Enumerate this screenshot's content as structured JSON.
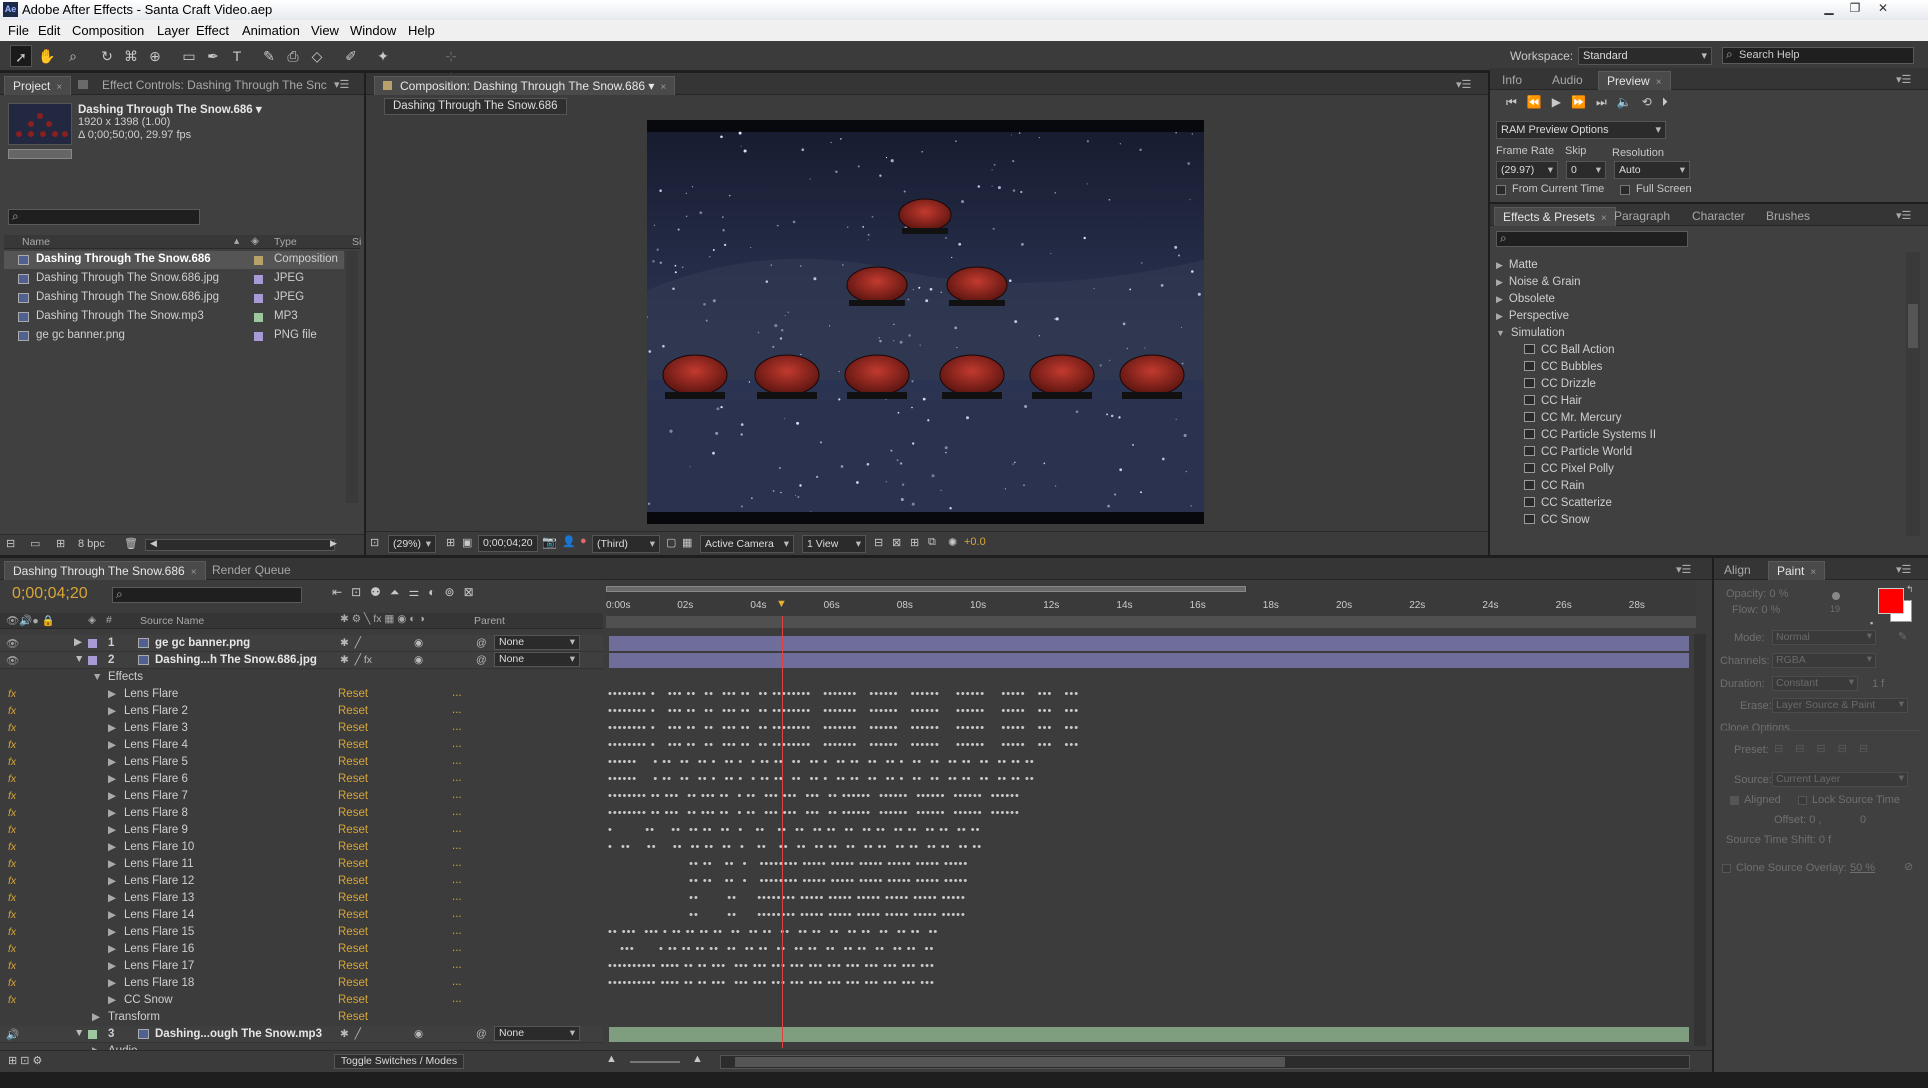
{
  "window": {
    "title": "Adobe After Effects - Santa Craft Video.aep",
    "app_icon": "Ae"
  },
  "menu": [
    "File",
    "Edit",
    "Composition",
    "Layer",
    "Effect",
    "Animation",
    "View",
    "Window",
    "Help"
  ],
  "toolbar": {
    "workspace_label": "Workspace:",
    "workspace_value": "Standard",
    "search_help_placeholder": "Search Help"
  },
  "project_panel": {
    "tabs": [
      "Project",
      "Effect Controls: Dashing Through The Snc"
    ],
    "selected_name": "Dashing Through The Snow.686 ▾",
    "selected_info1": "1920 x 1398 (1.00)",
    "selected_info2": "Δ 0;00;50;00, 29.97 fps",
    "columns": {
      "name": "Name",
      "type": "Type",
      "size": "Si"
    },
    "items": [
      {
        "name": "Dashing Through The Snow.686",
        "type": "Composition",
        "color": "#b9a26a",
        "icon": "composition-icon"
      },
      {
        "name": "Dashing Through The Snow.686.jpg",
        "type": "JPEG",
        "color": "#a79ad6",
        "icon": "image-icon"
      },
      {
        "name": "Dashing Through The Snow.686.jpg",
        "type": "JPEG",
        "color": "#a79ad6",
        "icon": "image-icon"
      },
      {
        "name": "Dashing Through The Snow.mp3",
        "type": "MP3",
        "color": "#9dc79d",
        "icon": "audio-icon"
      },
      {
        "name": "ge gc banner.png",
        "type": "PNG file",
        "color": "#a79ad6",
        "icon": "image-icon"
      }
    ],
    "bpc": "8 bpc"
  },
  "composition_panel": {
    "tab": "Composition: Dashing Through The Snow.686",
    "subtab": "Dashing Through The Snow.686",
    "zoom": "(29%)",
    "timecode": "0;00;04;20",
    "resolution": "(Third)",
    "camera": "Active Camera",
    "views": "1 View",
    "exposure": "+0.0"
  },
  "preview_panel": {
    "tabs": [
      "Info",
      "Audio",
      "Preview"
    ],
    "ram_preview": "RAM Preview Options",
    "frame_rate_label": "Frame Rate",
    "skip_label": "Skip",
    "resolution_label": "Resolution",
    "frame_rate": "(29.97)",
    "skip": "0",
    "resolution": "Auto",
    "from_current_time": "From Current Time",
    "full_screen": "Full Screen"
  },
  "effects_panel": {
    "tabs": [
      "Effects & Presets",
      "Paragraph",
      "Character",
      "Brushes"
    ],
    "categories": [
      "Matte",
      "Noise & Grain",
      "Obsolete",
      "Perspective",
      "Simulation"
    ],
    "simulation_items": [
      "CC Ball Action",
      "CC Bubbles",
      "CC Drizzle",
      "CC Hair",
      "CC Mr. Mercury",
      "CC Particle Systems II",
      "CC Particle World",
      "CC Pixel Polly",
      "CC Rain",
      "CC Scatterize",
      "CC Snow"
    ]
  },
  "timeline": {
    "tabs": [
      "Dashing Through The Snow.686",
      "Render Queue"
    ],
    "timecode": "0;00;04;20",
    "ruler": [
      "0:00s",
      "02s",
      "04s",
      "06s",
      "08s",
      "10s",
      "12s",
      "14s",
      "16s",
      "18s",
      "20s",
      "22s",
      "24s",
      "26s",
      "28s"
    ],
    "columns": {
      "num": "#",
      "source": "Source Name",
      "parent": "Parent"
    },
    "layers": [
      {
        "num": "1",
        "name": "ge gc banner.png",
        "parent": "None",
        "color": "#a79ad6"
      },
      {
        "num": "2",
        "name": "Dashing...h The Snow.686.jpg",
        "parent": "None",
        "color": "#a79ad6"
      },
      {
        "num": "3",
        "name": "Dashing...ough The Snow.mp3",
        "parent": "None",
        "color": "#9dc79d"
      }
    ],
    "effects_label": "Effects",
    "effects": [
      "Lens Flare",
      "Lens Flare 2",
      "Lens Flare 3",
      "Lens Flare 4",
      "Lens Flare 5",
      "Lens Flare 6",
      "Lens Flare 7",
      "Lens Flare 8",
      "Lens Flare 9",
      "Lens Flare 10",
      "Lens Flare 11",
      "Lens Flare 12",
      "Lens Flare 13",
      "Lens Flare 14",
      "Lens Flare 15",
      "Lens Flare 16",
      "Lens Flare 17",
      "Lens Flare 18",
      "CC Snow"
    ],
    "reset_label": "Reset",
    "ellipsis": "...",
    "transform_label": "Transform",
    "audio_label": "Audio",
    "toggle_label": "Toggle Switches / Modes"
  },
  "paint_panel": {
    "tabs": [
      "Align",
      "Paint"
    ],
    "opacity": "Opacity: 0 %",
    "flow": "Flow: 0 %",
    "brush_size": "19",
    "mode_label": "Mode:",
    "mode": "Normal",
    "channels_label": "Channels:",
    "channels": "RGBA",
    "duration_label": "Duration:",
    "duration": "Constant",
    "duration_value": "1 f",
    "erase_label": "Erase:",
    "erase": "Layer Source & Paint",
    "clone_options": "Clone Options",
    "preset_label": "Preset:",
    "source_label": "Source:",
    "source": "Current Layer",
    "aligned": "Aligned",
    "lock_source_time": "Lock Source Time",
    "offset": "Offset: 0 ,",
    "offset_y": "0",
    "source_time_shift": "Source Time Shift: 0 f",
    "clone_overlay": "Clone Source Overlay:",
    "clone_overlay_value": "50 %",
    "fg_color": "#ff0000",
    "bg_color": "#ffffff"
  }
}
